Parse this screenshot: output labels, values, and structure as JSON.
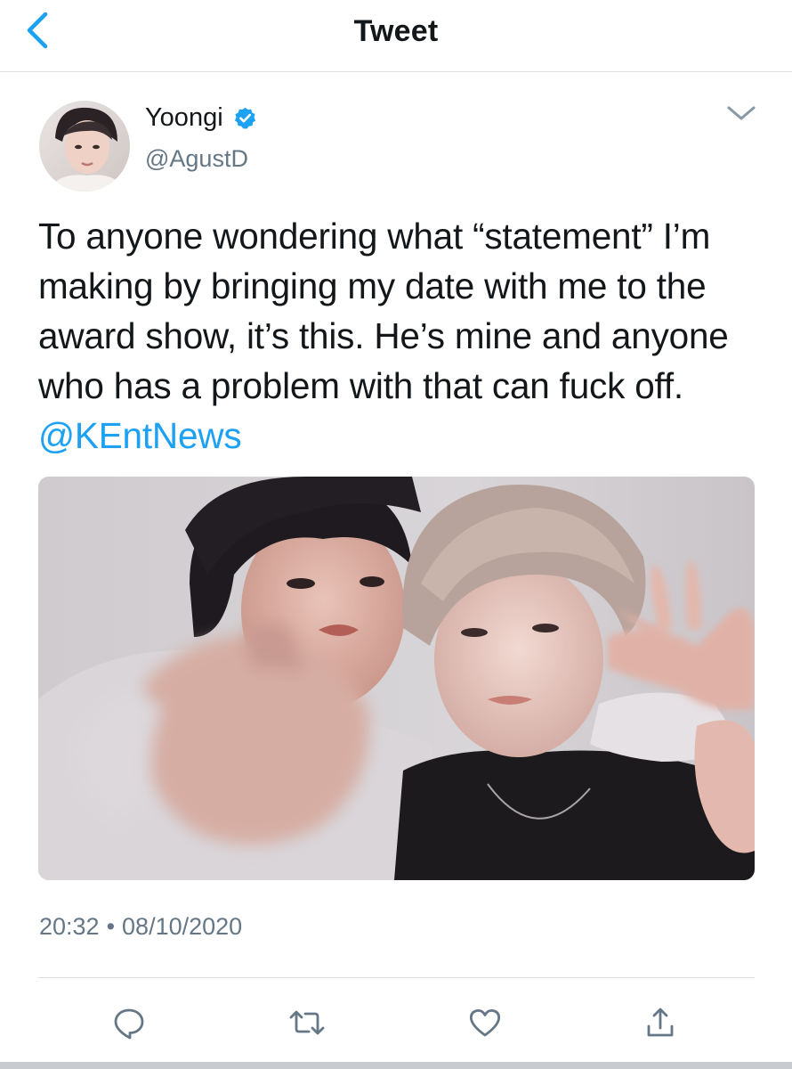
{
  "header": {
    "title": "Tweet"
  },
  "author": {
    "name": "Yoongi",
    "handle": "@AgustD",
    "verified": true
  },
  "tweet": {
    "text": "To anyone wondering what “statement” I’m making by bringing my date with me to the award show, it’s this. He’s mine and anyone who has a problem with that can fuck off.",
    "mention": "@KEntNews"
  },
  "meta": {
    "time": "20:32",
    "separator": "•",
    "date": "08/10/2020"
  },
  "actions": [
    "reply-icon",
    "retweet-icon",
    "like-icon",
    "share-icon"
  ],
  "colors": {
    "accent": "#1da1f2",
    "text": "#14171a",
    "secondary": "#657786",
    "divider": "#dcdfe2"
  }
}
